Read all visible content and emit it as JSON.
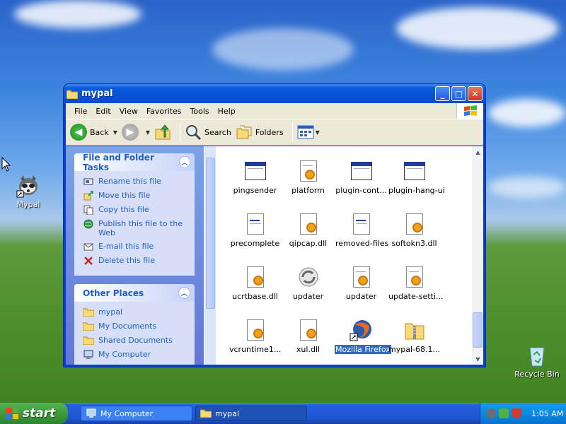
{
  "desktop": {
    "icons": [
      {
        "label": "Mypal"
      },
      {
        "label": "Recycle Bin"
      }
    ]
  },
  "window": {
    "title": "mypal",
    "menu": [
      "File",
      "Edit",
      "View",
      "Favorites",
      "Tools",
      "Help"
    ],
    "toolbar": {
      "back": "Back",
      "search": "Search",
      "folders": "Folders"
    }
  },
  "taskpane": {
    "file_tasks": {
      "title": "File and Folder Tasks",
      "items": [
        {
          "label": "Rename this file",
          "icon": "rename-icon"
        },
        {
          "label": "Move this file",
          "icon": "move-icon"
        },
        {
          "label": "Copy this file",
          "icon": "copy-icon"
        },
        {
          "label": "Publish this file to the Web",
          "icon": "globe-icon"
        },
        {
          "label": "E-mail this file",
          "icon": "email-icon"
        },
        {
          "label": "Delete this file",
          "icon": "delete-icon"
        }
      ]
    },
    "other_places": {
      "title": "Other Places",
      "items": [
        {
          "label": "mypal",
          "icon": "folder-icon"
        },
        {
          "label": "My Documents",
          "icon": "folder-icon"
        },
        {
          "label": "Shared Documents",
          "icon": "folder-icon"
        },
        {
          "label": "My Computer",
          "icon": "computer-icon"
        }
      ]
    }
  },
  "files": [
    {
      "label": "pingsender",
      "type": "exe"
    },
    {
      "label": "platform",
      "type": "settings"
    },
    {
      "label": "plugin-cont...",
      "type": "exe"
    },
    {
      "label": "plugin-hang-ui",
      "type": "exe"
    },
    {
      "label": "precomplete",
      "type": "doc"
    },
    {
      "label": "qipcap.dll",
      "type": "dll"
    },
    {
      "label": "removed-files",
      "type": "doc"
    },
    {
      "label": "softokn3.dll",
      "type": "dll"
    },
    {
      "label": "ucrtbase.dll",
      "type": "dll"
    },
    {
      "label": "updater",
      "type": "updater"
    },
    {
      "label": "updater",
      "type": "settings"
    },
    {
      "label": "update-setti...",
      "type": "settings"
    },
    {
      "label": "vcruntime1...",
      "type": "dll"
    },
    {
      "label": "xul.dll",
      "type": "dll"
    },
    {
      "label": "Mozilla Firefox",
      "type": "shortcut",
      "selected": true
    },
    {
      "label": "mypal-68.1...",
      "type": "zip"
    }
  ],
  "taskbar": {
    "start": "start",
    "tasks": [
      {
        "label": "My Computer",
        "active": false
      },
      {
        "label": "mypal",
        "active": true
      }
    ],
    "clock": "1:05 AM"
  }
}
